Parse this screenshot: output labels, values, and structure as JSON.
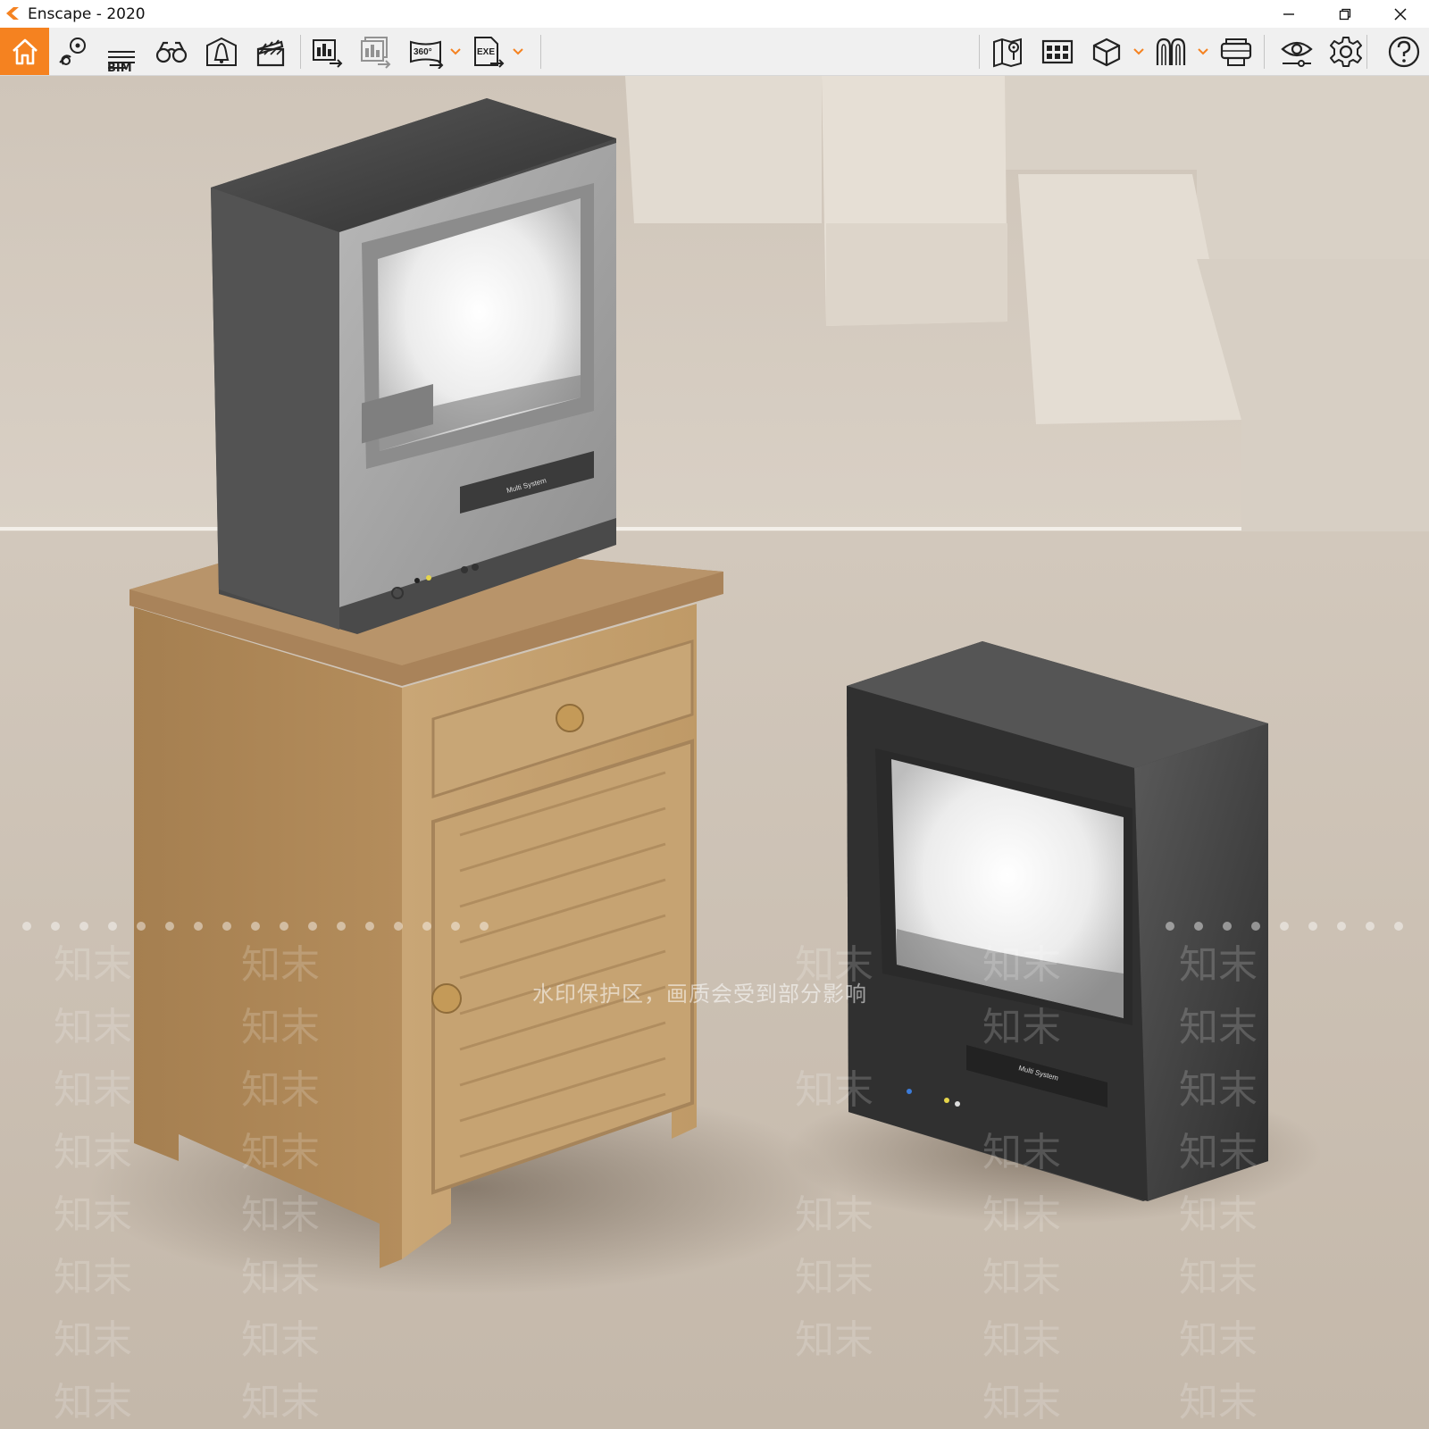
{
  "window": {
    "title": "Enscape - 2020",
    "controls": [
      "minimize",
      "restore",
      "close"
    ]
  },
  "toolbar": {
    "accent_color": "#f58220",
    "bim_label": "BIM",
    "left_tools": [
      {
        "name": "home",
        "icon": "home-icon"
      },
      {
        "name": "views",
        "icon": "map-pin-views-icon"
      },
      {
        "name": "bim",
        "icon": "bim-list-icon"
      },
      {
        "name": "orthographic",
        "icon": "binoculars-icon"
      },
      {
        "name": "atmosphere",
        "icon": "sun-house-icon"
      },
      {
        "name": "video-editor",
        "icon": "clapperboard-icon"
      },
      {
        "name": "screenshot",
        "icon": "render-export-icon"
      },
      {
        "name": "batch-render",
        "icon": "batch-render-icon"
      },
      {
        "name": "panorama",
        "icon": "panorama-360-icon",
        "label": "360°"
      },
      {
        "name": "exe-export",
        "icon": "exe-export-icon",
        "label": "EXE"
      }
    ],
    "right_tools": [
      {
        "name": "minimap",
        "icon": "map-icon"
      },
      {
        "name": "asset-library",
        "icon": "asset-grid-icon"
      },
      {
        "name": "material-editor",
        "icon": "cube-icon"
      },
      {
        "name": "collaborative-annotation",
        "icon": "arches-icon"
      },
      {
        "name": "vr-headset",
        "icon": "vr-headset-icon"
      },
      {
        "name": "visual-settings",
        "icon": "eye-settings-icon"
      },
      {
        "name": "general-settings",
        "icon": "gear-icon"
      },
      {
        "name": "help",
        "icon": "help-icon"
      }
    ]
  },
  "viewport": {
    "watermark_notice": "水印保护区，画质会受到部分影响",
    "watermark_brand": "知末",
    "scene": {
      "tv_front_label": "Multi System",
      "wall_color": "#d8cfc4",
      "floor_color": "#cbbfb2",
      "cabinet_wood": "#b38d5c"
    }
  }
}
